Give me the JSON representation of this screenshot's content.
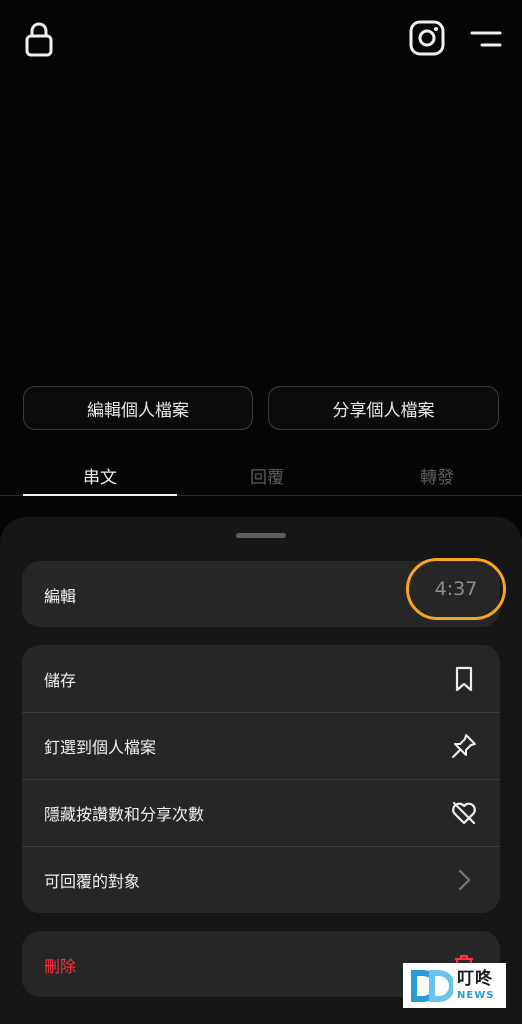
{
  "header": {
    "lock_icon": "lock-icon",
    "instagram_icon": "instagram-icon",
    "menu_icon": "menu-icon"
  },
  "profile": {
    "edit_profile_label": "編輯個人檔案",
    "share_profile_label": "分享個人檔案"
  },
  "tabs": [
    {
      "label": "串文",
      "active": true
    },
    {
      "label": "回覆",
      "active": false
    },
    {
      "label": "轉發",
      "active": false
    }
  ],
  "sheet": {
    "edit": {
      "label": "編輯",
      "time": "4:37"
    },
    "options": [
      {
        "label": "儲存",
        "icon": "bookmark-icon"
      },
      {
        "label": "釘選到個人檔案",
        "icon": "pin-icon"
      },
      {
        "label": "隱藏按讚數和分享次數",
        "icon": "heart-off-icon"
      },
      {
        "label": "可回覆的對象",
        "icon": "chevron-right-icon"
      }
    ],
    "delete": {
      "label": "刪除",
      "icon": "trash-icon"
    }
  },
  "watermark": {
    "name": "叮咚",
    "sub": "NEWS"
  },
  "colors": {
    "background": "#050505",
    "sheet": "#161616",
    "card": "#262626",
    "danger": "#ff3040",
    "highlight_ring": "#f7a520",
    "watermark_blue": "#2a9bd8"
  }
}
